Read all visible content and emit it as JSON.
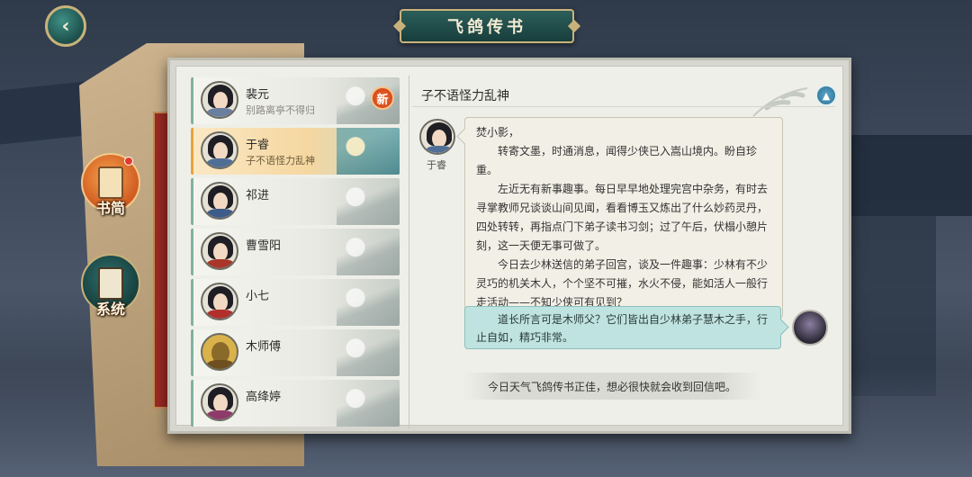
{
  "header": {
    "back_label": "‹",
    "title": "飞鸽传书"
  },
  "side_tabs": {
    "mail": {
      "label": "书简",
      "icon": "scroll-icon",
      "has_notification": true
    },
    "system": {
      "label": "系统",
      "icon": "scroll-icon"
    }
  },
  "contacts": [
    {
      "name": "裴元",
      "subtitle": "别路离亭不得归",
      "badge": "新",
      "active": false
    },
    {
      "name": "于睿",
      "subtitle": "子不语怪力乱神",
      "badge": "",
      "active": true
    },
    {
      "name": "祁进",
      "subtitle": "",
      "badge": "",
      "active": false
    },
    {
      "name": "曹雪阳",
      "subtitle": "",
      "badge": "",
      "active": false
    },
    {
      "name": "小七",
      "subtitle": "",
      "badge": "",
      "active": false
    },
    {
      "name": "木师傅",
      "subtitle": "",
      "badge": "",
      "active": false
    },
    {
      "name": "高绛婷",
      "subtitle": "",
      "badge": "",
      "active": false
    }
  ],
  "conversation": {
    "title": "子不语怪力乱神",
    "sender_name": "于睿",
    "letter": {
      "salutation": "焚小影，",
      "paragraphs": [
        "转寄文墨，时通消息，闻得少侠已入嵩山境内。盼自珍重。",
        "左近无有新事趣事。每日早早地处理完宫中杂务，有时去寻掌教师兄谈谈山间见闻，看看博玉又炼出了什么妙药灵丹，四处转转，再指点门下弟子读书习剑；过了午后，伏榻小憩片刻，这一天便无事可做了。",
        "今日去少林送信的弟子回宫，谈及一件趣事：少林有不少灵巧的机关木人，个个坚不可摧，水火不侵，能如活人一般行走活动——不知少侠可有见到？"
      ]
    },
    "reply": "道长所言可是木师父？它们皆出自少林弟子慧木之手，行止自如，精巧非常。",
    "status": "今日天气飞鸽传书正佳，想必很快就会收到回信吧。"
  },
  "colors": {
    "accent_teal": "#2c5e5a",
    "gold_border": "#c9b27a",
    "active_row": "#f5d7a0",
    "reply_bubble": "#bfe3e0",
    "badge_orange": "#f26c2c"
  }
}
